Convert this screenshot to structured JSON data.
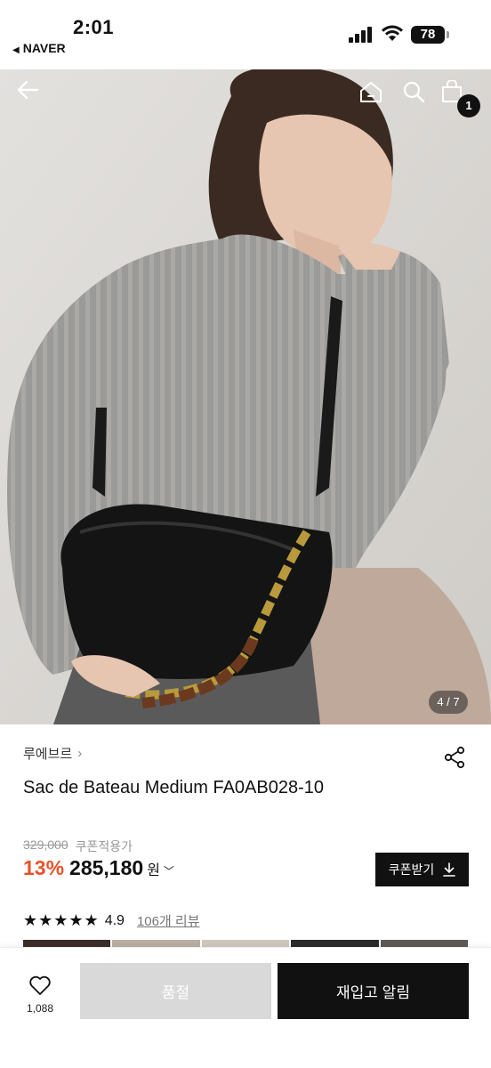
{
  "status_bar": {
    "time": "2:01",
    "back_app": "NAVER",
    "battery": "78"
  },
  "header": {
    "cart_count": "1"
  },
  "gallery": {
    "counter": "4 / 7"
  },
  "product": {
    "brand": "루에브르",
    "title": "Sac de Bateau Medium FA0AB028-10",
    "original_price": "329,000",
    "coupon_price_label": "쿠폰적용가",
    "discount": "13%",
    "price": "285,180",
    "currency": "원",
    "coupon_button": "쿠폰받기",
    "rating_stars": "★★★★★",
    "rating": "4.9",
    "review_link": "106개 리뷰"
  },
  "bottom_bar": {
    "wish_count": "1,088",
    "soldout_label": "품절",
    "restock_label": "재입고 알림"
  },
  "colors": {
    "accent_discount": "#e8522a",
    "primary_button": "#111111",
    "disabled_button": "#d9d9d9"
  },
  "icons": [
    "back-arrow-icon",
    "home-icon",
    "search-icon",
    "shopping-bag-icon",
    "share-icon",
    "heart-icon",
    "download-icon",
    "chevron-right-icon",
    "chevron-down-icon"
  ]
}
